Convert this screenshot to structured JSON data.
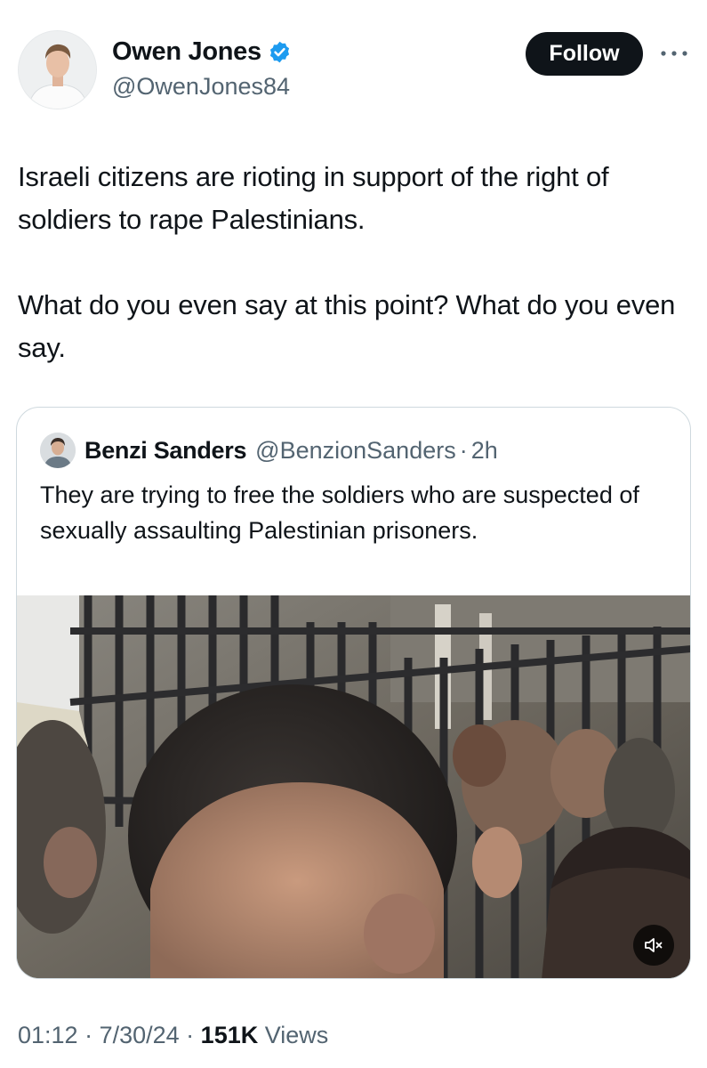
{
  "author": {
    "name": "Owen Jones",
    "handle": "@OwenJones84",
    "verified": true,
    "avatar_icon": "profile-photo"
  },
  "follow_label": "Follow",
  "more_icon": "more-options-icon",
  "tweet": {
    "paragraphs": [
      "Israeli citizens are rioting in support of the right of soldiers to rape Palestinians.",
      "What do you even say at this point? What do you even say."
    ]
  },
  "quoted": {
    "name": "Benzi Sanders",
    "handle": "@BenzionSanders",
    "separator": "·",
    "time": "2h",
    "text": "They are trying to free the soldiers who are suspected of sexually assaulting Palestinian prisoners.",
    "media": {
      "type": "video",
      "muted": true,
      "mute_icon": "speaker-muted-icon"
    }
  },
  "meta": {
    "time": "01:12",
    "sep1": " · ",
    "date": "7/30/24",
    "sep2": " · ",
    "views_count": "151K",
    "views_label": " Views"
  },
  "colors": {
    "text": "#0f1419",
    "secondary": "#536471",
    "verified_blue": "#1d9bf0",
    "border": "#cfd9de",
    "button_bg": "#0f1419"
  }
}
